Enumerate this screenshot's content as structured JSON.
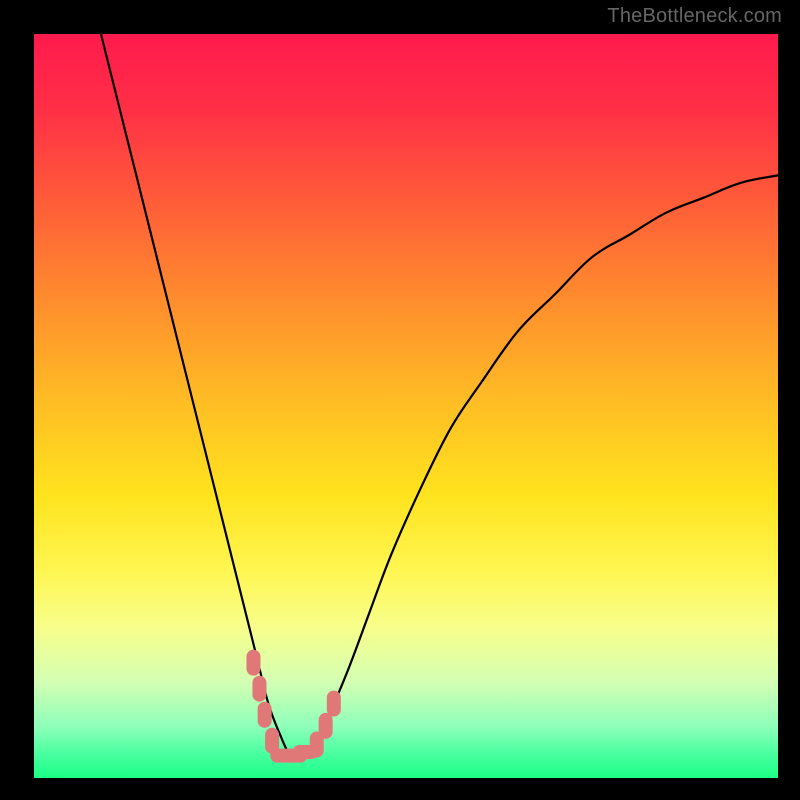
{
  "watermark": "TheBottleneck.com",
  "gradient": {
    "stops": [
      {
        "offset": 0.0,
        "color": "#ff1a4d"
      },
      {
        "offset": 0.1,
        "color": "#ff2f46"
      },
      {
        "offset": 0.22,
        "color": "#ff5a39"
      },
      {
        "offset": 0.35,
        "color": "#ff8a2e"
      },
      {
        "offset": 0.5,
        "color": "#ffbf24"
      },
      {
        "offset": 0.62,
        "color": "#ffe31e"
      },
      {
        "offset": 0.72,
        "color": "#fff651"
      },
      {
        "offset": 0.8,
        "color": "#f7ff8c"
      },
      {
        "offset": 0.87,
        "color": "#d4ffb3"
      },
      {
        "offset": 0.93,
        "color": "#8fffba"
      },
      {
        "offset": 0.97,
        "color": "#45ff9e"
      },
      {
        "offset": 1.0,
        "color": "#1aff85"
      }
    ]
  },
  "chart_data": {
    "type": "line",
    "title": "",
    "xlabel": "",
    "ylabel": "",
    "xlim": [
      0,
      100
    ],
    "ylim": [
      0,
      100
    ],
    "series": [
      {
        "name": "curve",
        "x": [
          9,
          12,
          15,
          18,
          21,
          24,
          27,
          28.5,
          30,
          31.5,
          33,
          34.5,
          36,
          37.5,
          39,
          42,
          45,
          48,
          52,
          56,
          60,
          65,
          70,
          75,
          80,
          85,
          90,
          95,
          100
        ],
        "y": [
          100,
          88,
          76,
          64,
          52,
          40,
          28,
          22,
          16,
          10,
          6,
          3,
          3,
          4,
          7,
          14,
          22,
          30,
          39,
          47,
          53,
          60,
          65,
          70,
          73,
          76,
          78,
          80,
          81
        ]
      }
    ],
    "highlight": {
      "name": "bottleneck-marker",
      "color": "#e07878",
      "points": [
        {
          "x": 29.5,
          "y": 15.5
        },
        {
          "x": 30.3,
          "y": 12.0
        },
        {
          "x": 31.0,
          "y": 8.5
        },
        {
          "x": 32.0,
          "y": 5.0
        },
        {
          "x": 33.5,
          "y": 3.0
        },
        {
          "x": 35.0,
          "y": 3.0
        },
        {
          "x": 36.5,
          "y": 3.5
        },
        {
          "x": 38.0,
          "y": 4.5
        },
        {
          "x": 39.2,
          "y": 7.0
        },
        {
          "x": 40.3,
          "y": 10.0
        }
      ]
    }
  }
}
